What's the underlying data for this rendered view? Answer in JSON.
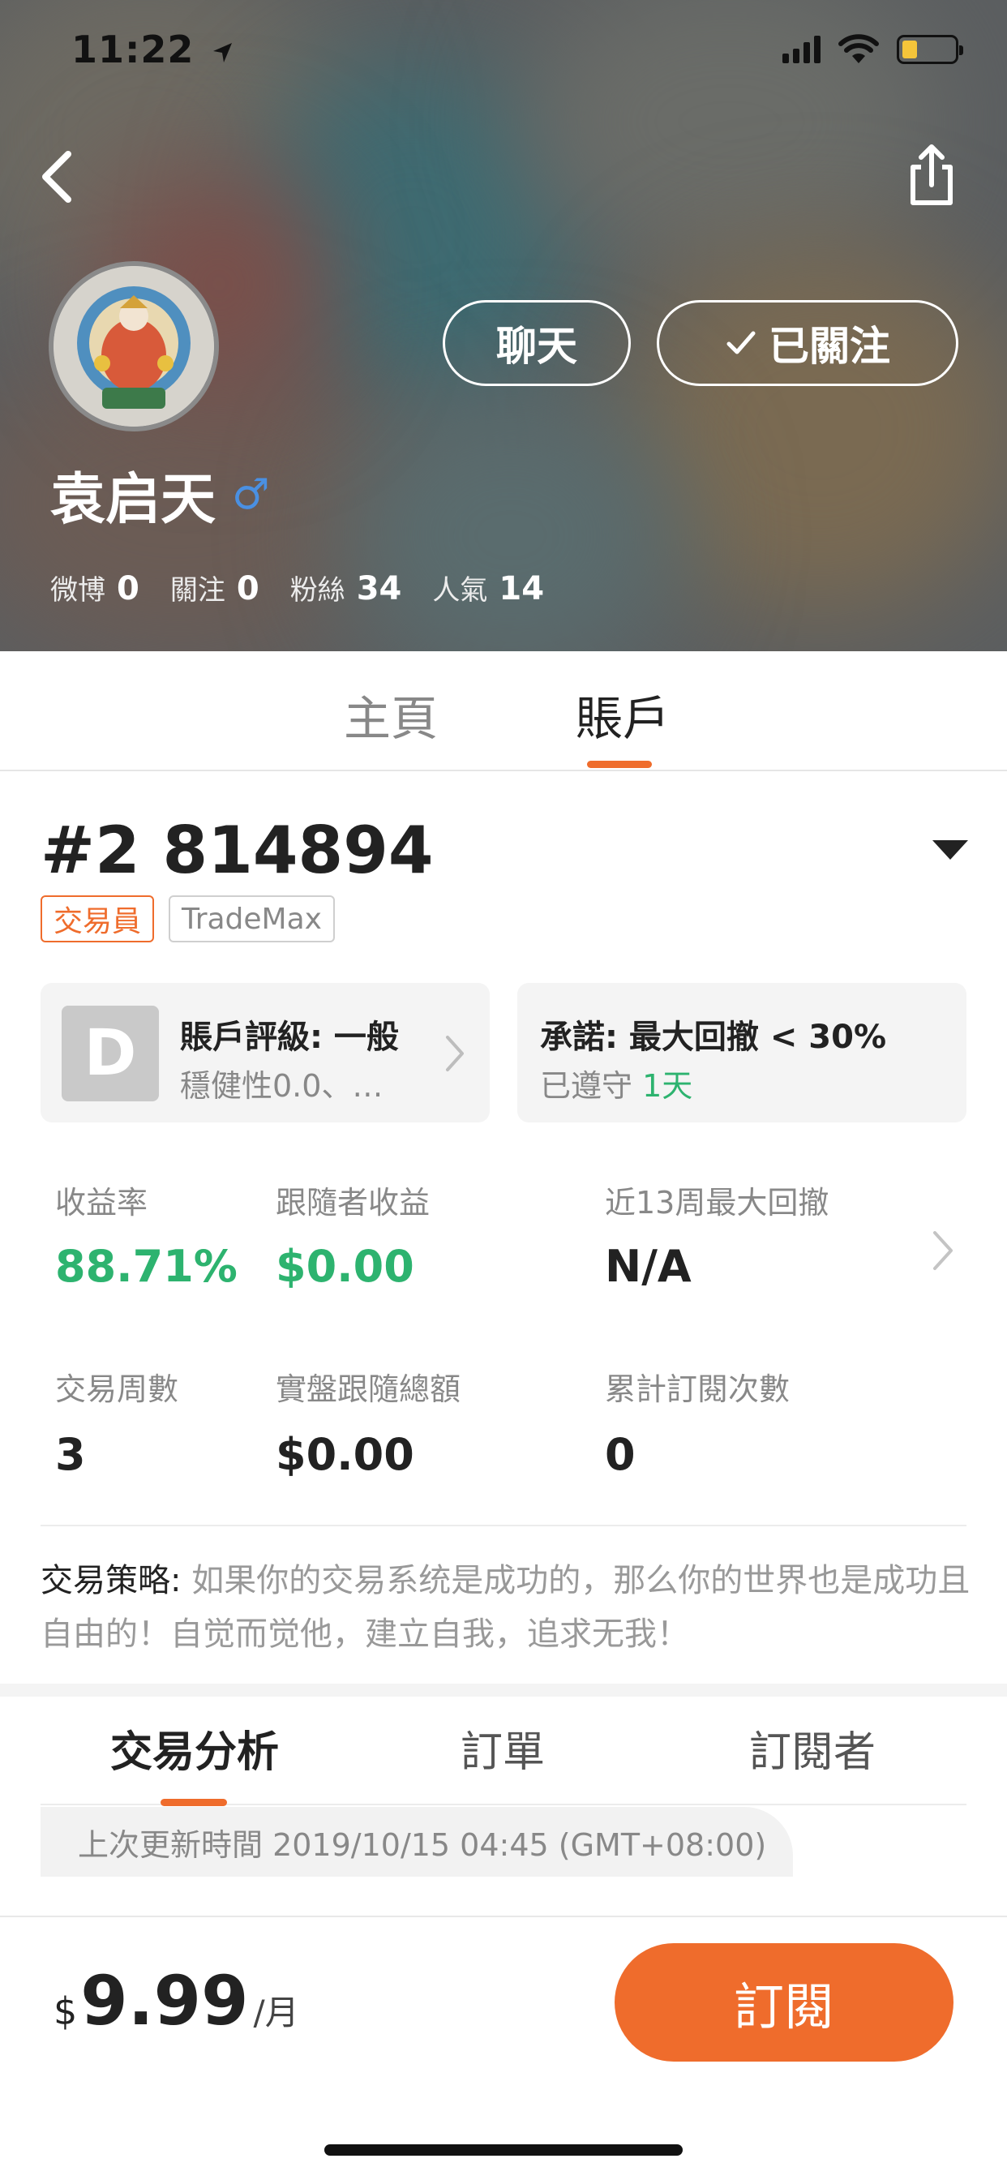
{
  "status_bar": {
    "time": "11:22"
  },
  "profile": {
    "name": "袁启天",
    "gender_symbol": "♂",
    "chat_label": "聊天",
    "follow_label": "已關注",
    "stats": [
      {
        "label": "微博",
        "value": "0"
      },
      {
        "label": "關注",
        "value": "0"
      },
      {
        "label": "粉絲",
        "value": "34"
      },
      {
        "label": "人氣",
        "value": "14"
      }
    ]
  },
  "main_tabs": [
    {
      "label": "主頁",
      "active": false
    },
    {
      "label": "賬戶",
      "active": true
    }
  ],
  "account": {
    "number": "#2 814894",
    "tags": [
      "交易員",
      "TradeMax"
    ],
    "rating_grade": "D",
    "rating_title": "賬戶評級: 一般",
    "rating_sub": "穩健性0.0、…",
    "promise_title": "承諾: 最大回撤 < 30%",
    "promise_sub": "已遵守",
    "promise_days": "1天"
  },
  "metrics": [
    {
      "label": "收益率",
      "value": "88.71%",
      "color": "#2db36f"
    },
    {
      "label": "跟隨者收益",
      "value": "$0.00",
      "color": "#2db36f"
    },
    {
      "label": "近13周最大回撤",
      "value": "N/A"
    },
    {
      "label": "交易周數",
      "value": "3"
    },
    {
      "label": "實盤跟隨總額",
      "value": "$0.00"
    },
    {
      "label": "累計訂閱次數",
      "value": "0"
    }
  ],
  "strategy": {
    "label": "交易策略:",
    "text": " 如果你的交易系统是成功的，那么你的世界也是成功且自由的！自觉而觉他，建立自我，追求无我！"
  },
  "sub_tabs": [
    {
      "label": "交易分析",
      "active": true
    },
    {
      "label": "訂單",
      "active": false
    },
    {
      "label": "訂閱者",
      "active": false
    }
  ],
  "last_update": "上次更新時間 2019/10/15 04:45 (GMT+08:00)",
  "subscription": {
    "currency": "$",
    "amount": "9.99",
    "period": "/月",
    "button_label": "訂閱"
  },
  "colors": {
    "accent": "#ef6c2c",
    "positive": "#2db36f",
    "gender": "#4a90e2"
  },
  "icons": [
    "navigation-arrow-icon",
    "signal-icon",
    "wifi-icon",
    "battery-icon",
    "back-icon",
    "share-icon",
    "checkmark-icon",
    "chevron-right-icon",
    "dropdown-triangle-icon"
  ]
}
